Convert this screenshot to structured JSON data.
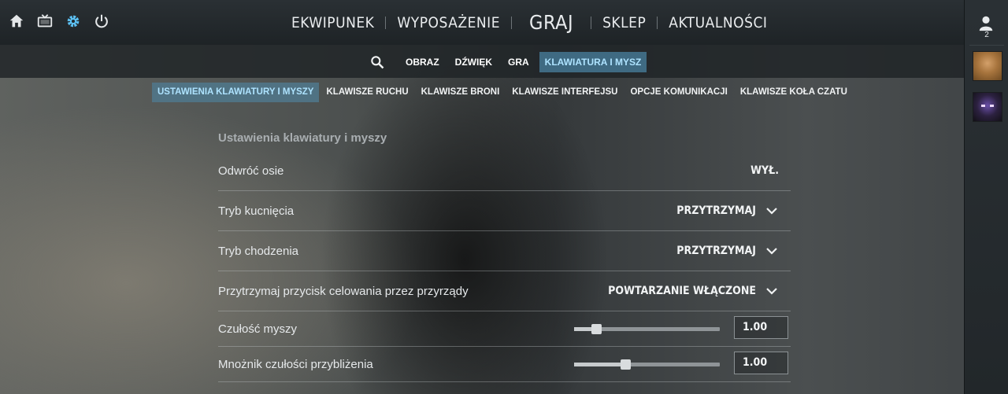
{
  "topnav": {
    "left_icons": [
      "home-icon",
      "tv-icon",
      "gear-icon",
      "power-icon"
    ],
    "items": [
      "EKWIPUNEK",
      "WYPOSAŻENIE",
      "GRAJ",
      "SKLEP",
      "AKTUALNOŚCI"
    ]
  },
  "subtabs": {
    "search_icon": "search-icon",
    "items": [
      "OBRAZ",
      "DŹWIĘK",
      "GRA",
      "KLAWIATURA I MYSZ"
    ],
    "active": "KLAWIATURA I MYSZ",
    "active_color": "#3f6a82"
  },
  "categories": {
    "items": [
      "USTAWIENIA KLAWIATURY I MYSZY",
      "KLAWISZE RUCHU",
      "KLAWISZE BRONI",
      "KLAWISZE INTERFEJSU",
      "OPCJE KOMUNIKACJI",
      "KLAWISZE KOŁA CZATU"
    ],
    "active": "USTAWIENIA KLAWIATURY I MYSZY"
  },
  "panel": {
    "title": "Ustawienia klawiatury i myszy",
    "rows": [
      {
        "label": "Odwróć osie",
        "value": "WYŁ."
      },
      {
        "label": "Tryb kucnięcia",
        "value": "PRZYTRZYMAJ"
      },
      {
        "label": "Tryb chodzenia",
        "value": "PRZYTRZYMAJ"
      },
      {
        "label": "Przytrzymaj przycisk celowania przez przyrządy",
        "value": "POWTARZANIE WŁĄCZONE"
      }
    ],
    "sliders": [
      {
        "label": "Czułość myszy",
        "value": "1.00",
        "level": 0.15
      },
      {
        "label": "Mnożnik czułości przybliżenia",
        "value": "1.00",
        "level": 0.35
      }
    ]
  },
  "sidebar": {
    "friends_icon": "person-icon",
    "friends_count": "2"
  },
  "colors": {
    "accent": "#aee3ff",
    "bar": "#1e2326"
  }
}
